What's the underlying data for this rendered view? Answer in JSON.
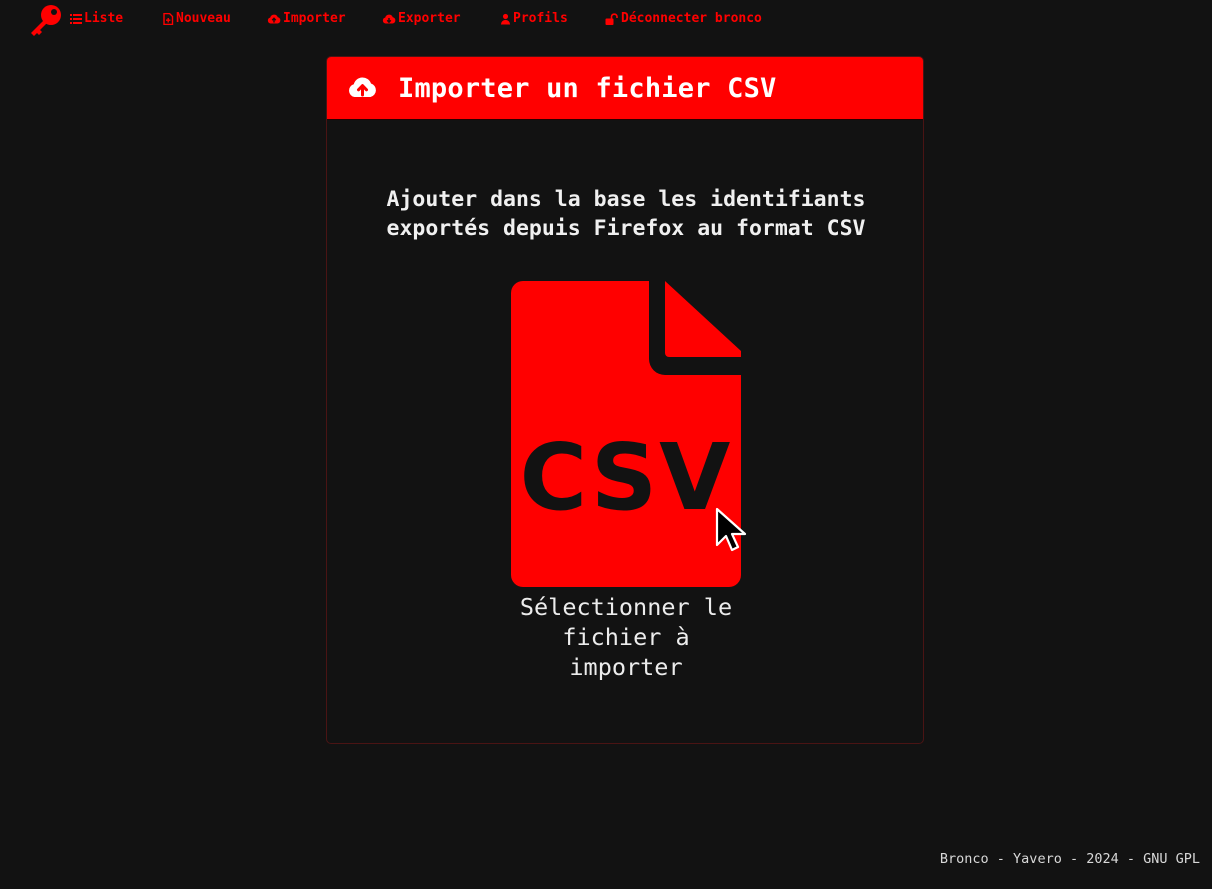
{
  "navbar": {
    "logo_icon": "key-icon",
    "items": [
      {
        "label": "Liste",
        "icon": "list-icon"
      },
      {
        "label": "Nouveau",
        "icon": "new-file-icon"
      },
      {
        "label": "Importer",
        "icon": "cloud-upload-icon"
      },
      {
        "label": "Exporter",
        "icon": "cloud-download-icon"
      },
      {
        "label": "Profils",
        "icon": "user-icon"
      },
      {
        "label": "Déconnecter bronco",
        "icon": "unlock-icon"
      }
    ]
  },
  "card": {
    "header_icon": "cloud-upload-icon",
    "title": "Importer un fichier CSV",
    "description": "Ajouter dans la base les identifiants exportés depuis Firefox au format CSV",
    "file_icon": "csv-file-icon",
    "file_icon_text": "CSV",
    "picker_label": "Sélectionner le fichier à importer"
  },
  "footer": {
    "text": "Bronco - Yavero - 2024 - GNU GPL"
  },
  "colors": {
    "accent": "#ff0000",
    "background": "#121212",
    "text": "#ffffff"
  }
}
